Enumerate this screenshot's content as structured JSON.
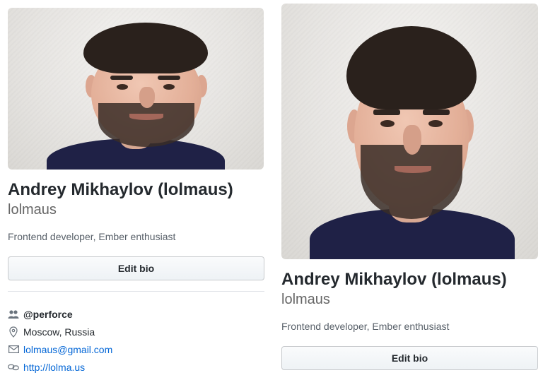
{
  "left_card": {
    "fullname": "Andrey Mikhaylov (lolmaus)",
    "username": "lolmaus",
    "bio": "Frontend developer, Ember enthusiast",
    "edit_bio_label": "Edit bio",
    "details": {
      "organization": "@perforce",
      "location": "Moscow, Russia",
      "email": "lolmaus@gmail.com",
      "website": "http://lolma.us"
    },
    "icons": {
      "organization": "people-icon",
      "location": "location-pin-icon",
      "email": "mail-icon",
      "website": "link-icon"
    }
  },
  "right_card": {
    "fullname": "Andrey Mikhaylov (lolmaus)",
    "username": "lolmaus",
    "bio": "Frontend developer, Ember enthusiast",
    "edit_bio_label": "Edit bio"
  },
  "colors": {
    "text": "#24292e",
    "muted": "#586069",
    "link": "#0366d6",
    "shirt": "#1f2146",
    "button_border": "#c7cacd"
  }
}
